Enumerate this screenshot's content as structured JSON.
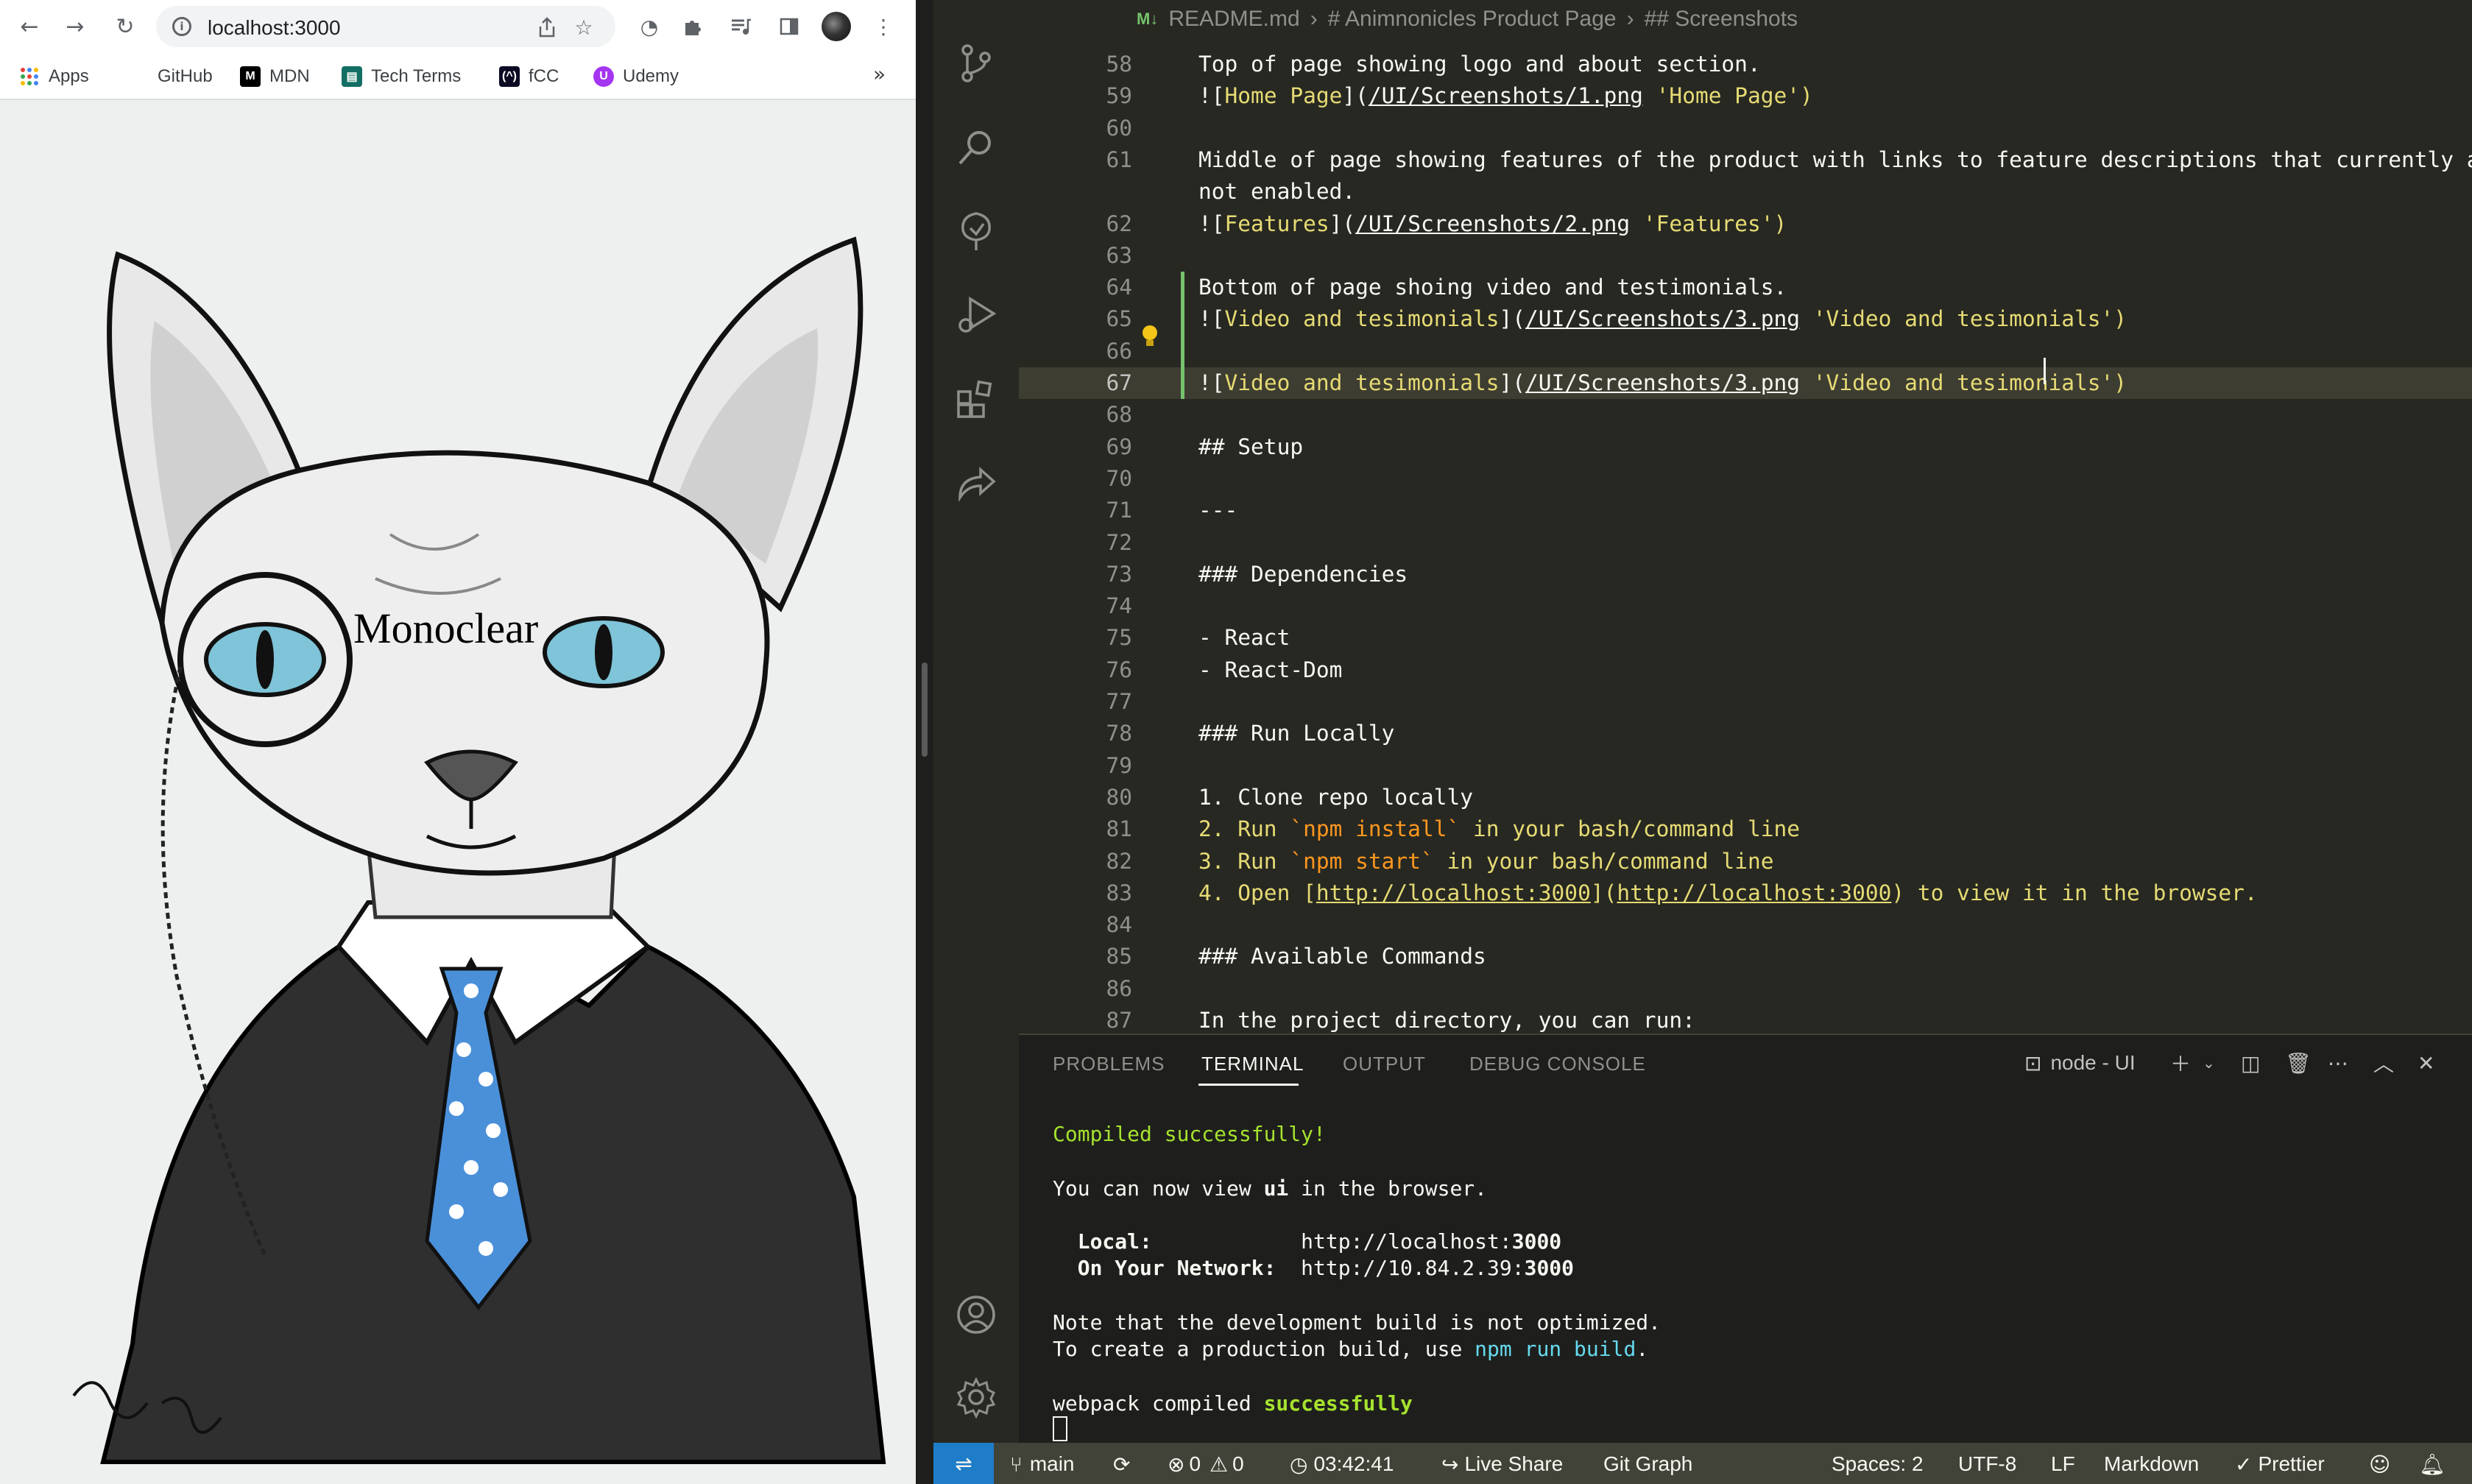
{
  "browser": {
    "url": "localhost:3000",
    "bookmarks": [
      {
        "label": "Apps"
      },
      {
        "label": "GitHub"
      },
      {
        "label": "MDN"
      },
      {
        "label": "Tech Terms"
      },
      {
        "label": "fCC"
      },
      {
        "label": "Udemy"
      }
    ],
    "overflow_glyph": "»",
    "page": {
      "heading": "Monoclear"
    }
  },
  "editor": {
    "breadcrumbs": {
      "file_badge": "M↓",
      "file": "README.md",
      "section1": "# Animnonicles Product Page",
      "section2": "## Screenshots"
    },
    "lines": [
      {
        "n": "58",
        "text": "Top of page showing logo and about section."
      },
      {
        "n": "59",
        "parts": [
          "![",
          "Home Page",
          "](",
          "/UI/Screenshots/1.png",
          " 'Home Page')"
        ]
      },
      {
        "n": "60",
        "text": ""
      },
      {
        "n": "61",
        "text": "Middle of page showing features of the product with links to feature descriptions that currently are",
        "wrap": "not enabled."
      },
      {
        "n": "62",
        "parts": [
          "![",
          "Features",
          "](",
          "/UI/Screenshots/2.png",
          " 'Features')"
        ]
      },
      {
        "n": "63",
        "text": ""
      },
      {
        "n": "64",
        "text": "Bottom of page shoing video and testimonials."
      },
      {
        "n": "65",
        "parts": [
          "![",
          "Video and tesimonials",
          "](",
          "/UI/Screenshots/3.png",
          " 'Video and tesimonials')"
        ]
      },
      {
        "n": "66",
        "text": ""
      },
      {
        "n": "67",
        "parts": [
          "![",
          "Video and tesimonials",
          "](",
          "/UI/Screenshots/3.png",
          " 'Video and tesimonials')"
        ]
      },
      {
        "n": "68",
        "text": ""
      },
      {
        "n": "69",
        "text": "## Setup"
      },
      {
        "n": "70",
        "text": ""
      },
      {
        "n": "71",
        "text": "---"
      },
      {
        "n": "72",
        "text": ""
      },
      {
        "n": "73",
        "text": "### Dependencies"
      },
      {
        "n": "74",
        "text": ""
      },
      {
        "n": "75",
        "text": "- React"
      },
      {
        "n": "76",
        "text": "- React-Dom"
      },
      {
        "n": "77",
        "text": ""
      },
      {
        "n": "78",
        "text": "### Run Locally"
      },
      {
        "n": "79",
        "text": ""
      },
      {
        "n": "80",
        "text": "1. Clone repo locally"
      },
      {
        "n": "81",
        "parts": [
          "2. Run ",
          "`npm install`",
          " in your bash/command line"
        ]
      },
      {
        "n": "82",
        "parts": [
          "3. Run ",
          "`npm start`",
          " in your bash/command line"
        ]
      },
      {
        "n": "83",
        "parts": [
          "4. Open [",
          "http://localhost:3000",
          "](",
          "http://localhost:3000",
          ") to view it in the browser."
        ]
      },
      {
        "n": "84",
        "text": ""
      },
      {
        "n": "85",
        "text": "### Available Commands"
      },
      {
        "n": "86",
        "text": ""
      },
      {
        "n": "87",
        "text": "In the project directory, you can run:"
      }
    ]
  },
  "panel": {
    "tabs": [
      "PROBLEMS",
      "TERMINAL",
      "OUTPUT",
      "DEBUG CONSOLE"
    ],
    "active_tab": "TERMINAL",
    "terminal_name": "node - UI",
    "terminal": {
      "compiled": "Compiled successfully!",
      "view_prefix": "You can now view ",
      "view_app": "ui",
      "view_suffix": " in the browser.",
      "local_label": "  Local:            ",
      "local_url_prefix": "http://localhost:",
      "local_port": "3000",
      "network_label": "  On Your Network:  ",
      "network_url_prefix": "http://10.84.2.39:",
      "network_port": "3000",
      "note1": "Note that the development build is not optimized.",
      "note2_prefix": "To create a production build, use ",
      "note2_cmd": "npm run build",
      "note2_suffix": ".",
      "webpack_prefix": "webpack compiled ",
      "webpack_status": "successfully"
    }
  },
  "statusbar": {
    "branch": "main",
    "errors": "0",
    "warnings": "0",
    "time": "03:42:41",
    "live_share": "Live Share",
    "git_graph": "Git Graph",
    "spaces": "Spaces: 2",
    "encoding": "UTF-8",
    "eol": "LF",
    "language": "Markdown",
    "prettier": "Prettier"
  },
  "colors": {
    "editor_bg": "#272822",
    "heading_green": "#a6e22e",
    "link_yellow": "#e6db74",
    "remote_blue": "#1e7cc8"
  }
}
